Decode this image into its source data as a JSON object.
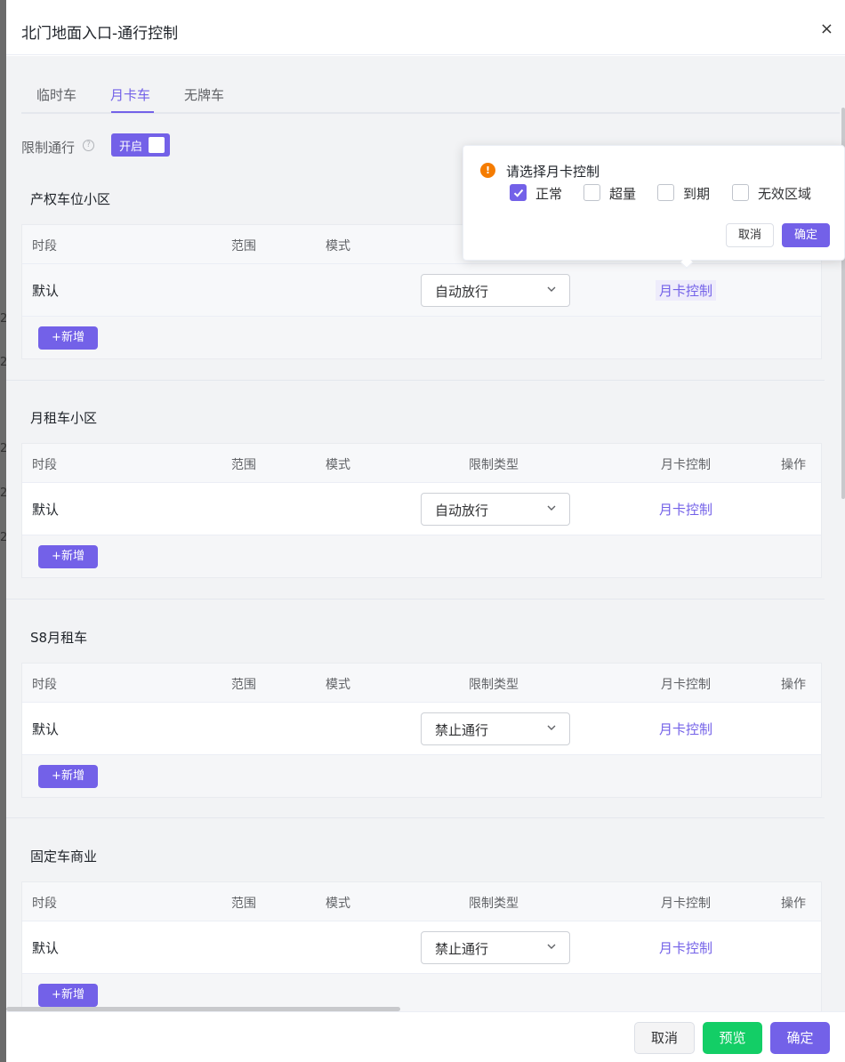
{
  "dialog": {
    "title": "北门地面入口-通行控制",
    "close_symbol": "×"
  },
  "left_edge_digits": [
    "2",
    "2",
    "2",
    "2",
    "2"
  ],
  "tabs": [
    {
      "label": "临时车",
      "active": false
    },
    {
      "label": "月卡车",
      "active": true
    },
    {
      "label": "无牌车",
      "active": false
    }
  ],
  "restrict": {
    "label": "限制通行",
    "help_icon": "question-circle-icon",
    "switch_text": "开启",
    "enabled": true
  },
  "table_headers": {
    "period": "时段",
    "range": "范围",
    "mode": "模式",
    "limit_type": "限制类型",
    "card_control": "月卡控制",
    "action": "操作"
  },
  "sections": [
    {
      "title": "产权车位小区",
      "row": {
        "period": "默认",
        "limit_type": "自动放行",
        "card_control": "月卡控制"
      },
      "add_label": "+新增"
    },
    {
      "title": "月租车小区",
      "row": {
        "period": "默认",
        "limit_type": "自动放行",
        "card_control": "月卡控制"
      },
      "add_label": "+新增"
    },
    {
      "title": "S8月租车",
      "row": {
        "period": "默认",
        "limit_type": "禁止通行",
        "card_control": "月卡控制"
      },
      "add_label": "+新增"
    },
    {
      "title": "固定车商业",
      "row": {
        "period": "默认",
        "limit_type": "禁止通行",
        "card_control": "月卡控制"
      },
      "add_label": "+新增"
    }
  ],
  "popover": {
    "icon": "warning-circle-icon",
    "title": "请选择月卡控制",
    "options": [
      {
        "label": "正常",
        "checked": true
      },
      {
        "label": "超量",
        "checked": false
      },
      {
        "label": "到期",
        "checked": false
      },
      {
        "label": "无效区域",
        "checked": false
      }
    ],
    "cancel_label": "取消",
    "confirm_label": "确定"
  },
  "footer": {
    "cancel_label": "取消",
    "preview_label": "预览",
    "confirm_label": "确定"
  },
  "colors": {
    "accent": "#7361e8",
    "preview_green": "#13ce66",
    "warning_orange": "#f57c00"
  }
}
